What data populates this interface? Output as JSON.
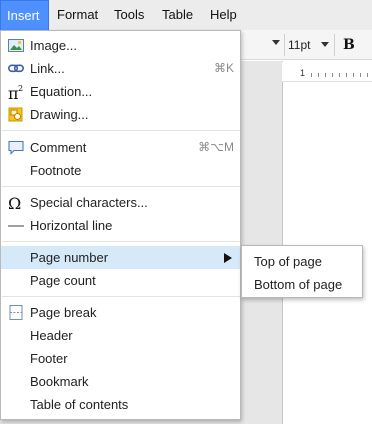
{
  "menubar": {
    "items": [
      {
        "label": "Insert",
        "active": true
      },
      {
        "label": "Format"
      },
      {
        "label": "Tools"
      },
      {
        "label": "Table"
      },
      {
        "label": "Help"
      }
    ]
  },
  "toolbar": {
    "font_size": "11pt",
    "bold_label": "B"
  },
  "ruler": {
    "number": "1"
  },
  "insert_menu": {
    "items": [
      {
        "label": "Image...",
        "icon": "image-icon"
      },
      {
        "label": "Link...",
        "icon": "link-icon",
        "shortcut": "⌘K"
      },
      {
        "label": "Equation...",
        "icon": "pi-squared-icon"
      },
      {
        "label": "Drawing...",
        "icon": "drawing-icon"
      },
      {
        "label": "Comment",
        "icon": "comment-icon",
        "shortcut": "⌘⌥M"
      },
      {
        "label": "Footnote"
      },
      {
        "label": "Special characters...",
        "icon": "omega-icon"
      },
      {
        "label": "Horizontal line",
        "icon": "horizontal-line-icon"
      },
      {
        "label": "Page number",
        "highlighted": true,
        "has_submenu": true
      },
      {
        "label": "Page count"
      },
      {
        "label": "Page break",
        "icon": "page-break-icon"
      },
      {
        "label": "Header"
      },
      {
        "label": "Footer"
      },
      {
        "label": "Bookmark"
      },
      {
        "label": "Table of contents"
      }
    ]
  },
  "page_number_submenu": {
    "items": [
      {
        "label": "Top of page"
      },
      {
        "label": "Bottom of page"
      }
    ]
  },
  "colors": {
    "active_menu": "#4d90fe",
    "hover_row": "#d6e9f8"
  }
}
